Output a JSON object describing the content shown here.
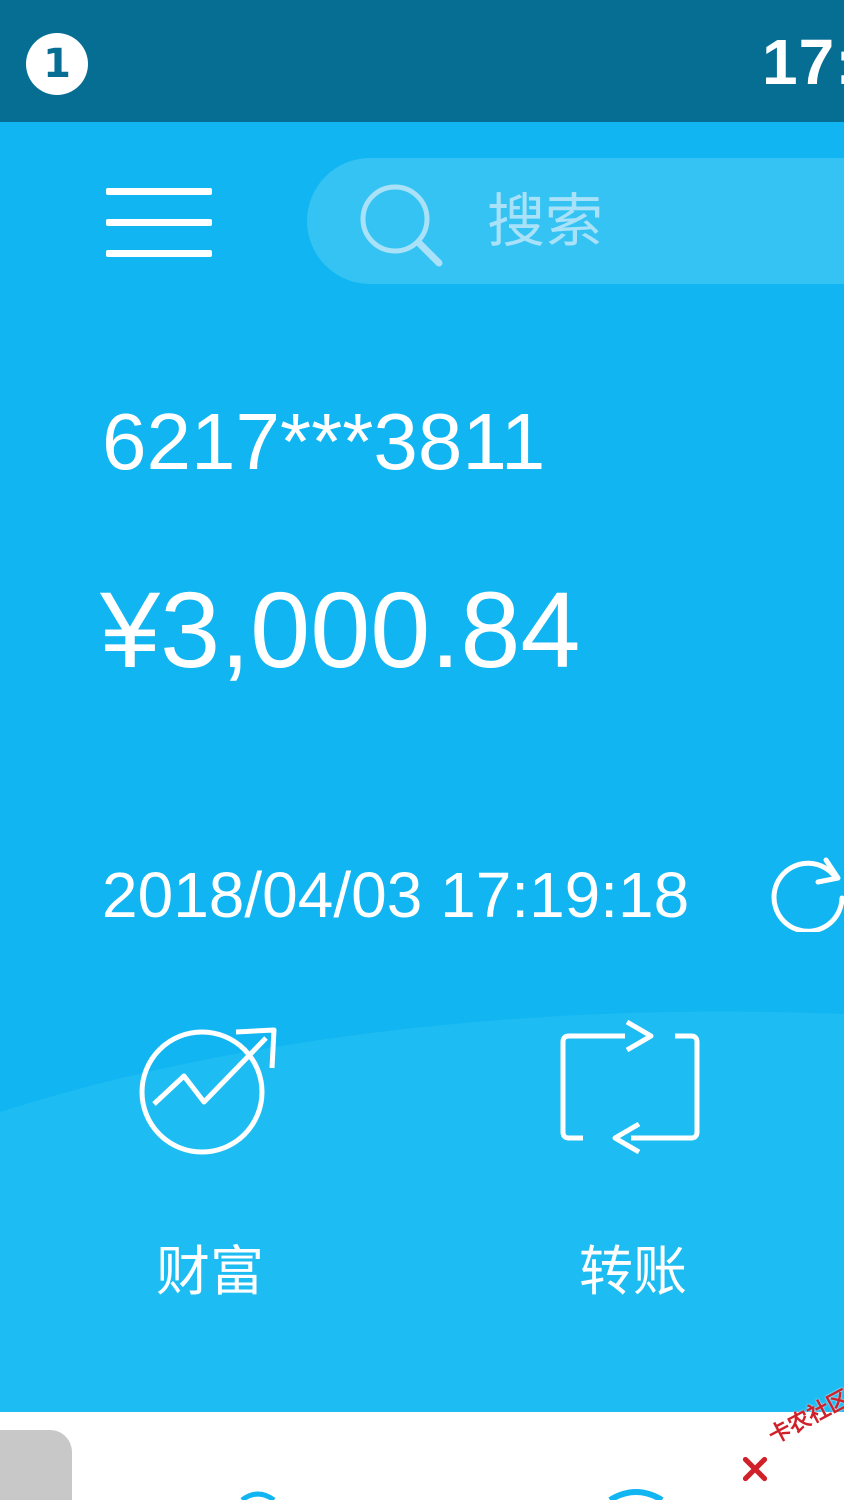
{
  "status_bar": {
    "notification_count": "1",
    "time": "17:"
  },
  "search": {
    "placeholder": "搜索"
  },
  "account": {
    "masked_number": "6217***3811",
    "balance": "¥3,000.84",
    "updated_at": "2018/04/03 17:19:18"
  },
  "actions": [
    {
      "label": "财富",
      "icon": "wealth-growth-icon"
    },
    {
      "label": "转账",
      "icon": "transfer-icon"
    }
  ],
  "watermark": {
    "text": "卡农社区"
  },
  "colors": {
    "status_bar": "#066e93",
    "header_blue": "#10b5f1",
    "search_bg": "#34c3f3",
    "watermark_red": "#d0212a"
  }
}
